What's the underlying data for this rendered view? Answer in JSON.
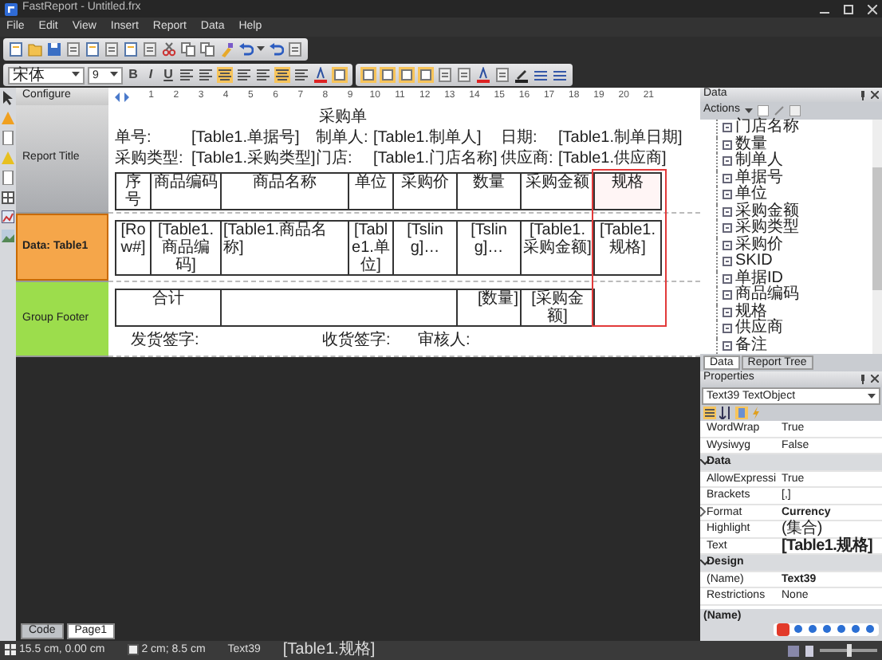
{
  "window": {
    "title": "FastReport - Untitled.frx"
  },
  "menu": [
    "File",
    "Edit",
    "View",
    "Insert",
    "Report",
    "Data",
    "Help"
  ],
  "toolbar": {
    "font": "宋体",
    "size": "9",
    "styles": [
      "B",
      "I",
      "U"
    ]
  },
  "bands_panel": {
    "title": "Configure",
    "bands": [
      {
        "label": "Report Title",
        "kind": "title",
        "selected": false
      },
      {
        "label": "Data: Table1",
        "kind": "data",
        "selected": true
      },
      {
        "label": "Group Footer",
        "kind": "footer",
        "selected": false
      }
    ]
  },
  "ruler": [
    "1",
    "2",
    "3",
    "4",
    "5",
    "6",
    "7",
    "8",
    "9",
    "10",
    "11",
    "12",
    "13",
    "14",
    "15",
    "16",
    "17",
    "18",
    "19",
    "20",
    "21"
  ],
  "report": {
    "title": "采购单",
    "header_fields": [
      {
        "label": "单号:",
        "value": "[Table1.单据号]"
      },
      {
        "label": "制单人:",
        "value": "[Table1.制单人]"
      },
      {
        "label": "日期:",
        "value": "[Table1.制单日期]"
      },
      {
        "label": "采购类型:",
        "value": "[Table1.采购类型]"
      },
      {
        "label": "门店:",
        "value": "[Table1.门店名称]"
      },
      {
        "label": "供应商:",
        "value": "[Table1.供应商]"
      }
    ],
    "columns": [
      {
        "label": "序号",
        "selected": false
      },
      {
        "label": "商品编码",
        "selected": false
      },
      {
        "label": "商品名称",
        "selected": false
      },
      {
        "label": "单位",
        "selected": false
      },
      {
        "label": "采购价",
        "selected": false
      },
      {
        "label": "数量",
        "selected": false
      },
      {
        "label": "采购金额",
        "selected": false
      },
      {
        "label": "规格",
        "selected": true
      }
    ],
    "row": [
      "[Row#]",
      "[Table1.商品编码]",
      "[Table1.商品名称]",
      "[Table1.单位]",
      "[Tsling]…",
      "[Tsling]…",
      "[Table1.采购金额]",
      "[Table1.规格]"
    ],
    "footer": {
      "label": "合计",
      "quantity": "[数量]",
      "amount": "[采购金额]"
    },
    "signatures": [
      "发货签字:",
      "收货签字:",
      "审核人:"
    ]
  },
  "page_tabs": [
    {
      "label": "Code",
      "selected": false
    },
    {
      "label": "Page1",
      "selected": true
    }
  ],
  "data_panel": {
    "title": "Data",
    "actions": "Actions",
    "fields": [
      "门店名称",
      "数量",
      "制单人",
      "单据号",
      "单位",
      "采购金额",
      "采购类型",
      "采购价",
      "SKID",
      "单据ID",
      "商品编码",
      "规格",
      "供应商",
      "备注"
    ],
    "tabs": [
      {
        "label": "Data",
        "selected": true
      },
      {
        "label": "Report Tree",
        "selected": false
      }
    ]
  },
  "properties": {
    "title": "Properties",
    "object": "Text39 TextObject",
    "rows": [
      {
        "kind": "prop",
        "name": "WordWrap",
        "value": "True",
        "modified": false,
        "expandable": false
      },
      {
        "kind": "prop",
        "name": "Wysiwyg",
        "value": "False",
        "modified": false,
        "expandable": false
      },
      {
        "kind": "group",
        "name": "Data",
        "expanded": true
      },
      {
        "kind": "prop",
        "name": "AllowExpressi",
        "value": "True",
        "modified": false,
        "expandable": false
      },
      {
        "kind": "prop",
        "name": "Brackets",
        "value": "[,]",
        "modified": false,
        "expandable": false
      },
      {
        "kind": "prop",
        "name": "Format",
        "value": "Currency",
        "modified": true,
        "expandable": true
      },
      {
        "kind": "prop",
        "name": "Highlight",
        "value": "(集合)",
        "modified": false,
        "expandable": false
      },
      {
        "kind": "prop",
        "name": "Text",
        "value": "[Table1.规格]",
        "modified": true,
        "expandable": false
      },
      {
        "kind": "group",
        "name": "Design",
        "expanded": true
      },
      {
        "kind": "prop",
        "name": "(Name)",
        "value": "Text39",
        "modified": true,
        "expandable": false
      },
      {
        "kind": "prop",
        "name": "Restrictions",
        "value": "None",
        "modified": false,
        "expandable": false
      }
    ],
    "description": "(Name)"
  },
  "status_bar": {
    "position": "15.5 cm, 0.00 cm",
    "size": "2 cm; 8.5 cm",
    "object": "Text39",
    "text": "[Table1.规格]",
    "zoom": {
      "level": 0.5
    }
  }
}
